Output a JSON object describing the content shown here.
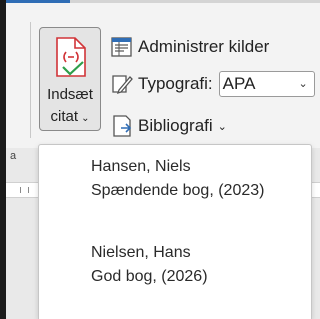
{
  "insert_citation": {
    "line1": "Indsæt",
    "line2": "citat",
    "chevron": "⌄",
    "icon": "insert-citation-icon"
  },
  "manage_sources": {
    "label": "Administrer kilder",
    "icon": "manage-sources-icon"
  },
  "style": {
    "label": "Typografi:",
    "value": "APA",
    "chevron": "⌄",
    "icon": "style-icon"
  },
  "bibliography": {
    "label": "Bibliografi",
    "chevron": "⌄",
    "icon": "bibliography-icon"
  },
  "citations": [
    {
      "author": "Hansen, Niels",
      "title": "Spændende bog, (2023)"
    },
    {
      "author": "Nielsen, Hans",
      "title": "God bog, (2026)"
    }
  ],
  "colors": {
    "accent": "#2f6db5",
    "citation_icon_red": "#d13438",
    "citation_icon_green": "#2e9e4a"
  }
}
